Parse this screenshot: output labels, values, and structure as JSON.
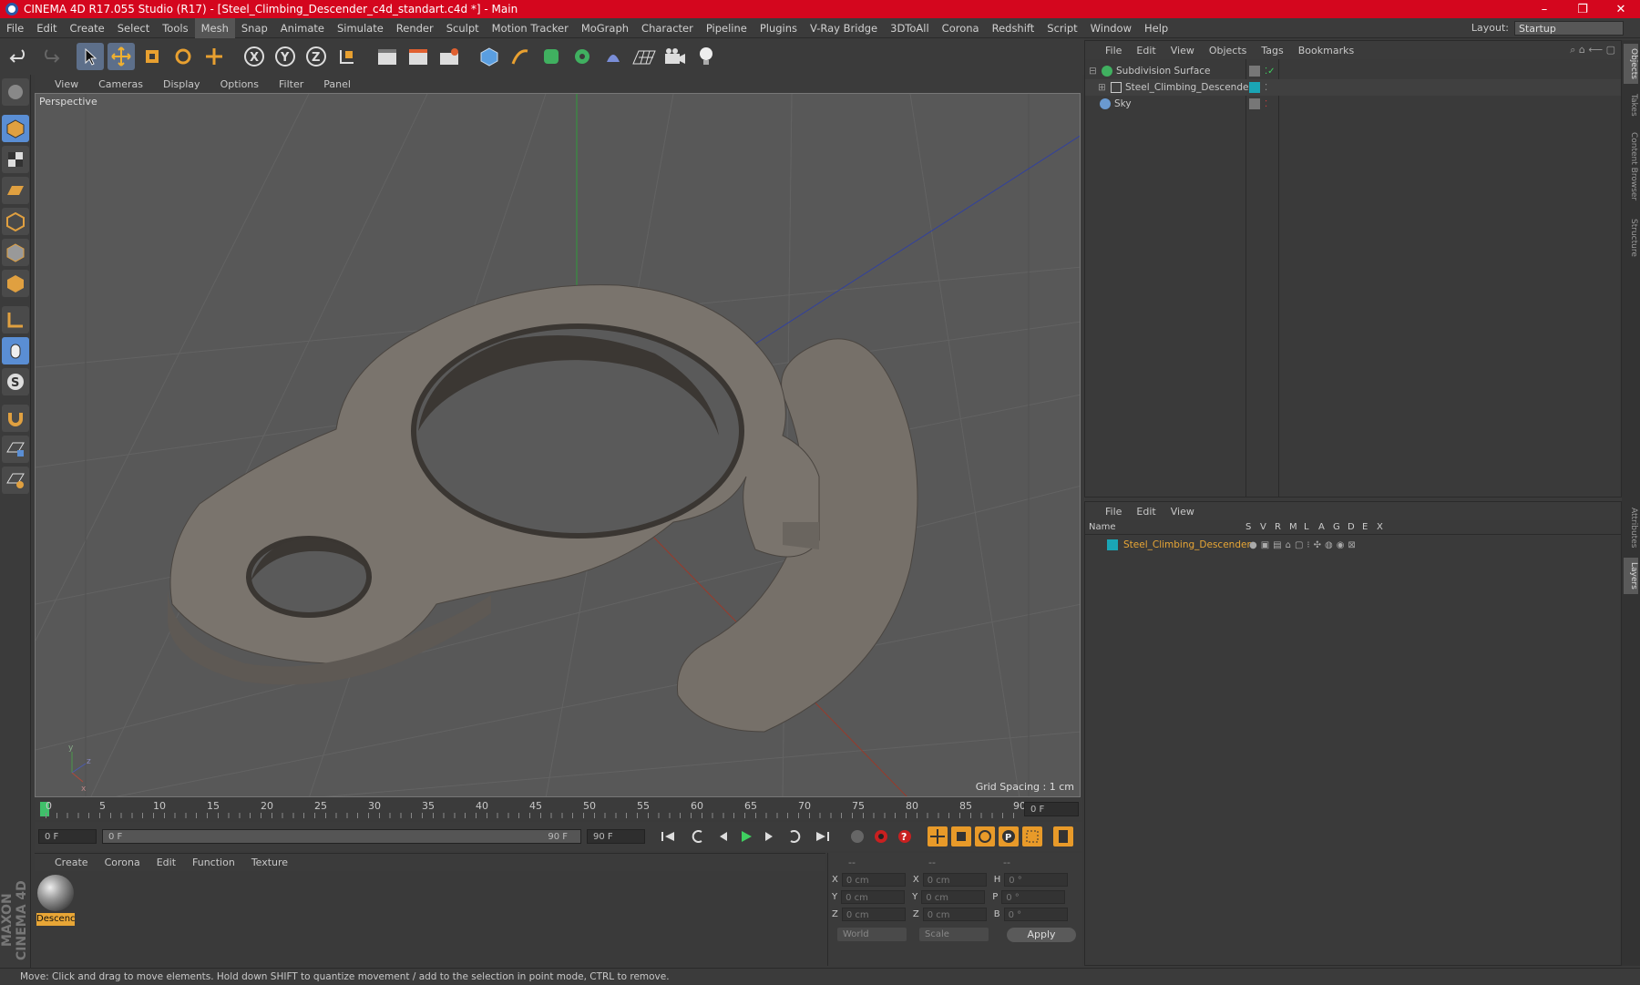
{
  "window": {
    "title": "CINEMA 4D R17.055 Studio (R17) - [Steel_Climbing_Descender_c4d_standart.c4d *] - Main"
  },
  "menubar": {
    "items": [
      "File",
      "Edit",
      "Create",
      "Select",
      "Tools",
      "Mesh",
      "Snap",
      "Animate",
      "Simulate",
      "Render",
      "Sculpt",
      "Motion Tracker",
      "MoGraph",
      "Character",
      "Pipeline",
      "Plugins",
      "V-Ray Bridge",
      "3DToAll",
      "Corona",
      "Redshift",
      "Script",
      "Window",
      "Help"
    ],
    "active": "Mesh",
    "layout_label": "Layout:",
    "layout_value": "Startup"
  },
  "viewport": {
    "menu": [
      "View",
      "Cameras",
      "Display",
      "Options",
      "Filter",
      "Panel"
    ],
    "label": "Perspective",
    "grid_spacing": "Grid Spacing : 1 cm"
  },
  "timeline": {
    "ticks": [
      "0",
      "5",
      "10",
      "15",
      "20",
      "25",
      "30",
      "35",
      "40",
      "45",
      "50",
      "55",
      "60",
      "65",
      "70",
      "75",
      "80",
      "85",
      "90"
    ],
    "end_field": "0 F",
    "start_field": "0 F",
    "slider_start": "0 F",
    "slider_end": "90 F",
    "max_field": "90 F"
  },
  "material_manager": {
    "menu": [
      "Create",
      "Corona",
      "Edit",
      "Function",
      "Texture"
    ],
    "materials": [
      {
        "name": "Descenc"
      }
    ]
  },
  "coordinates": {
    "header": [
      "--",
      "--",
      "--"
    ],
    "rows": [
      {
        "a": "X",
        "av": "0 cm",
        "b": "X",
        "bv": "0 cm",
        "c": "H",
        "cv": "0 °"
      },
      {
        "a": "Y",
        "av": "0 cm",
        "b": "Y",
        "bv": "0 cm",
        "c": "P",
        "cv": "0 °"
      },
      {
        "a": "Z",
        "av": "0 cm",
        "b": "Z",
        "bv": "0 cm",
        "c": "B",
        "cv": "0 °"
      }
    ],
    "mode1": "World",
    "mode2": "Scale",
    "apply": "Apply"
  },
  "object_manager": {
    "menu": [
      "File",
      "Edit",
      "View",
      "Objects",
      "Tags",
      "Bookmarks"
    ],
    "objects": [
      {
        "name": "Subdivision Surface",
        "color": "#c8c8c8"
      },
      {
        "name": "Steel_Climbing_Descender",
        "color": "#c8c8c8"
      },
      {
        "name": "Sky",
        "color": "#c8c8c8"
      }
    ]
  },
  "layer_manager": {
    "menu": [
      "File",
      "Edit",
      "View"
    ],
    "columns": [
      "Name",
      "S",
      "V",
      "R",
      "M",
      "L",
      "A",
      "G",
      "D",
      "E",
      "X"
    ],
    "layers": [
      {
        "name": "Steel_Climbing_Descender",
        "color": "#e8a636"
      }
    ]
  },
  "right_tabs": [
    "Objects",
    "Takes",
    "Content Browser",
    "Structure",
    "Attributes",
    "Layers"
  ],
  "status": {
    "text": "Move: Click and drag to move elements. Hold down SHIFT to quantize movement / add to the selection in point mode, CTRL to remove."
  },
  "colors": {
    "accent": "#d4061e",
    "selection": "#e8a636",
    "teal": "#1aa5b5"
  }
}
